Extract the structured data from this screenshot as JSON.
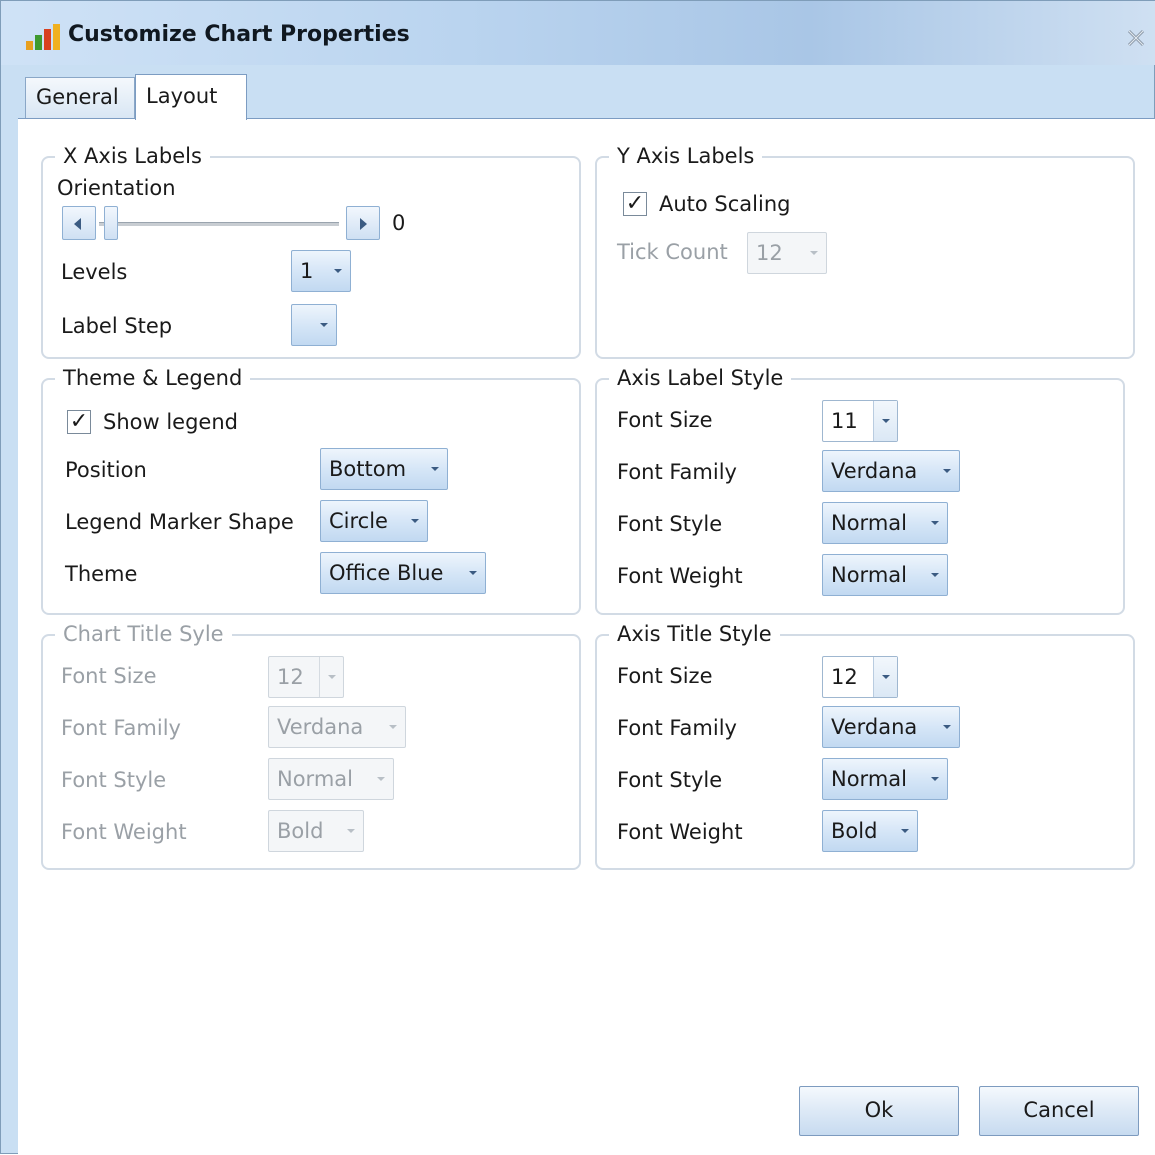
{
  "window": {
    "title": "Customize Chart Properties"
  },
  "tabs": [
    {
      "label": "General",
      "active": false
    },
    {
      "label": "Layout",
      "active": true
    }
  ],
  "x_axis_labels": {
    "legend": "X Axis Labels",
    "orientation_label": "Orientation",
    "orientation_value": "0",
    "levels_label": "Levels",
    "levels_value": "1",
    "label_step_label": "Label Step",
    "label_step_value": ""
  },
  "y_axis_labels": {
    "legend": "Y Axis Labels",
    "auto_scaling_label": "Auto Scaling",
    "auto_scaling_checked": true,
    "tick_count_label": "Tick Count",
    "tick_count_value": "12"
  },
  "theme_legend": {
    "legend": "Theme & Legend",
    "show_legend_label": "Show legend",
    "show_legend_checked": true,
    "position_label": "Position",
    "position_value": "Bottom",
    "marker_shape_label": "Legend Marker Shape",
    "marker_shape_value": "Circle",
    "theme_label": "Theme",
    "theme_value": "Office Blue"
  },
  "axis_label_style": {
    "legend": "Axis Label Style",
    "font_size_label": "Font Size",
    "font_size_value": "11",
    "font_family_label": "Font Family",
    "font_family_value": "Verdana",
    "font_style_label": "Font Style",
    "font_style_value": "Normal",
    "font_weight_label": "Font Weight",
    "font_weight_value": "Normal"
  },
  "chart_title_style": {
    "legend": "Chart Title Syle",
    "font_size_label": "Font Size",
    "font_size_value": "12",
    "font_family_label": "Font Family",
    "font_family_value": "Verdana",
    "font_style_label": "Font Style",
    "font_style_value": "Normal",
    "font_weight_label": "Font Weight",
    "font_weight_value": "Bold"
  },
  "axis_title_style": {
    "legend": "Axis Title Style",
    "font_size_label": "Font Size",
    "font_size_value": "12",
    "font_family_label": "Font Family",
    "font_family_value": "Verdana",
    "font_style_label": "Font Style",
    "font_style_value": "Normal",
    "font_weight_label": "Font Weight",
    "font_weight_value": "Bold"
  },
  "buttons": {
    "ok": "Ok",
    "cancel": "Cancel"
  },
  "icons": {
    "app": "bar-chart-icon",
    "close": "close-icon"
  },
  "colors": {
    "accent": "#c9dff3",
    "disabled_text": "#9aa0a6"
  }
}
